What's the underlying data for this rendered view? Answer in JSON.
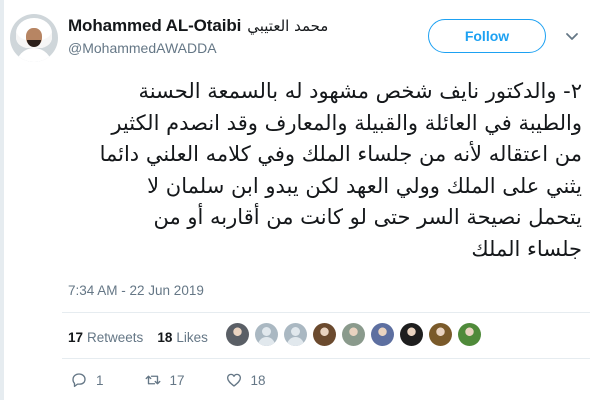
{
  "tweet": {
    "display_name": "Mohammed AL-Otaibi",
    "display_name_arabic": "محمد العتيبي",
    "handle": "@MohammedAWADDA",
    "follow_label": "Follow",
    "text_lines": [
      "٢- والدكتور نايف شخص مشهود له بالسمعة الحسنة",
      "والطيبة في العائلة والقبيلة والمعارف وقد انصدم الكثير",
      "من اعتقاله لأنه من جلساء الملك وفي كلامه العلني دائما",
      "يثني على الملك وولي العهد لكن يبدو ابن سلمان لا",
      "يتحمل نصيحة السر حتى لو كانت من أقاربه أو من",
      "جلساء الملك"
    ],
    "timestamp": "7:34 AM - 22 Jun 2019"
  },
  "stats": {
    "retweets_count": "17",
    "retweets_label": "Retweets",
    "likes_count": "18",
    "likes_label": "Likes"
  },
  "likers": [
    {
      "type": "photo",
      "color": "#5a5f66"
    },
    {
      "type": "default",
      "color": "#aab8c2"
    },
    {
      "type": "default",
      "color": "#aab8c2"
    },
    {
      "type": "photo",
      "color": "#6b4a2e"
    },
    {
      "type": "photo",
      "color": "#8a9a8c"
    },
    {
      "type": "photo",
      "color": "#5d6fa0"
    },
    {
      "type": "photo",
      "color": "#1e1e1e"
    },
    {
      "type": "photo",
      "color": "#7a5a2a"
    },
    {
      "type": "photo",
      "color": "#4f8a3a"
    }
  ],
  "actions": {
    "reply_count": "1",
    "retweet_count": "17",
    "like_count": "18"
  },
  "icons": {
    "reply": "reply-icon",
    "retweet": "retweet-icon",
    "like": "heart-icon",
    "caret": "chevron-down-icon"
  },
  "colors": {
    "accent": "#1da1f2",
    "secondary_text": "#657786",
    "primary_text": "#14171a"
  }
}
